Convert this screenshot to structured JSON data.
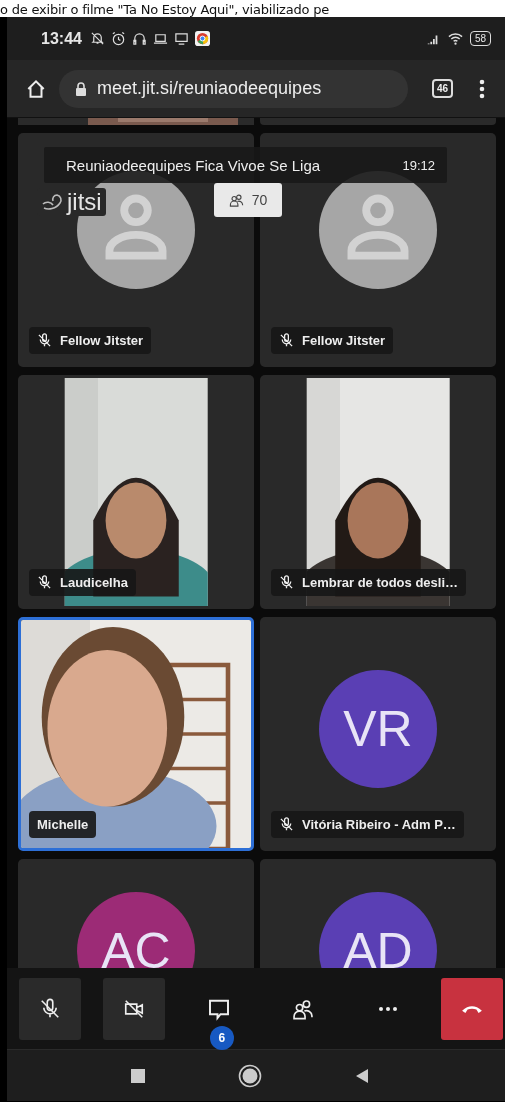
{
  "document_fragment": "o de exibir o filme \"Ta No Estoy Aqui\", viabilizado pe",
  "status_bar": {
    "time": "13:44",
    "battery": "58"
  },
  "browser": {
    "url": "meet.jit.si/reuniaodeequipes",
    "tab_count": "46"
  },
  "meeting": {
    "title": "Reuniaodeequipes Fica Vivoe Se Liga",
    "duration": "19:12",
    "logo": "jitsi",
    "participant_count": "70"
  },
  "top_row_cut": [
    {
      "kind": "video"
    },
    {
      "kind": "blank"
    }
  ],
  "tiles": [
    {
      "kind": "avatar",
      "name": "Fellow Jitster",
      "muted": true,
      "selected": false
    },
    {
      "kind": "avatar",
      "name": "Fellow Jitster",
      "muted": true,
      "selected": false
    },
    {
      "kind": "video",
      "pillarboxed": true,
      "name": "Laudicelha",
      "muted": true,
      "selected": false
    },
    {
      "kind": "video",
      "pillarboxed": true,
      "name": "Lembrar de todos desli…",
      "muted": true,
      "selected": false
    },
    {
      "kind": "video",
      "pillarboxed": false,
      "name": "Michelle",
      "muted": false,
      "selected": true
    },
    {
      "kind": "initials",
      "initials": "VR",
      "color": "#5a3fb4",
      "name": "Vitória Ribeiro - Adm P…",
      "muted": true,
      "selected": false
    },
    {
      "kind": "initials",
      "initials": "AC",
      "color": "#9c2b76",
      "selected": false
    },
    {
      "kind": "initials",
      "initials": "AD",
      "color": "#5a3fb4",
      "selected": false
    }
  ],
  "toolbar": [
    {
      "kind": "mic",
      "on": false
    },
    {
      "kind": "camera",
      "on": false
    },
    {
      "kind": "chat",
      "badge": "6"
    },
    {
      "kind": "participants"
    },
    {
      "kind": "more"
    },
    {
      "kind": "hangup"
    }
  ]
}
